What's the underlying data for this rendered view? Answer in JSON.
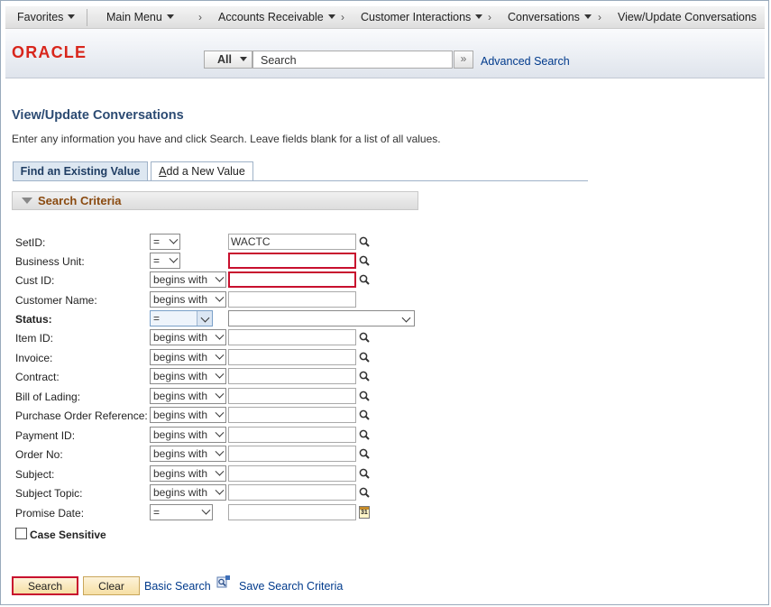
{
  "nav": {
    "favorites": "Favorites",
    "main_menu": "Main Menu",
    "breadcrumbs": [
      "Accounts Receivable",
      "Customer Interactions",
      "Conversations",
      "View/Update Conversations"
    ]
  },
  "header": {
    "logo_text": "ORACLE",
    "search_scope": "All",
    "search_placeholder": "Search",
    "search_go_icon": "double-chevron-right-icon",
    "advanced_search": "Advanced Search"
  },
  "page": {
    "title": "View/Update Conversations",
    "instructions": "Enter any information you have and click Search. Leave fields blank for a list of all values."
  },
  "tabs": {
    "find": "Find an Existing Value",
    "add": "Add a New Value",
    "add_underline_char": "A",
    "add_rest": "dd a New Value"
  },
  "criteria": {
    "title": "Search Criteria",
    "fields": [
      {
        "label": "SetID:",
        "operator": "=",
        "value": "WACTC"
      },
      {
        "label": "Business Unit:",
        "operator": "=",
        "value": ""
      },
      {
        "label": "Cust ID:",
        "operator": "begins with",
        "value": ""
      },
      {
        "label": "Customer Name:",
        "operator": "begins with",
        "value": ""
      },
      {
        "label": "Status:",
        "operator": "=",
        "value": ""
      },
      {
        "label": "Item ID:",
        "operator": "begins with",
        "value": ""
      },
      {
        "label": "Invoice:",
        "operator": "begins with",
        "value": ""
      },
      {
        "label": "Contract:",
        "operator": "begins with",
        "value": ""
      },
      {
        "label": "Bill of Lading:",
        "operator": "begins with",
        "value": ""
      },
      {
        "label": "Purchase Order Reference:",
        "operator": "begins with",
        "value": ""
      },
      {
        "label": "Payment ID:",
        "operator": "begins with",
        "value": ""
      },
      {
        "label": "Order No:",
        "operator": "begins with",
        "value": ""
      },
      {
        "label": "Subject:",
        "operator": "begins with",
        "value": ""
      },
      {
        "label": "Subject Topic:",
        "operator": "begins with",
        "value": ""
      },
      {
        "label": "Promise Date:",
        "operator": "=",
        "value": ""
      }
    ],
    "calendar_glyph": "31",
    "case_sensitive": "Case Sensitive"
  },
  "actions": {
    "search": "Search",
    "clear": "Clear",
    "basic_search": "Basic Search",
    "save_search": "Save Search Criteria"
  },
  "colors": {
    "title": "#2c4b73",
    "link": "#003a8c",
    "required_border": "#c8102e",
    "oracle_red": "#d8261c"
  }
}
